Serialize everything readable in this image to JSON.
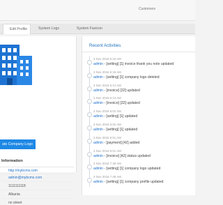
{
  "header": {
    "nav_label": "Customers"
  },
  "tabs": [
    {
      "label": "Edit Profile"
    },
    {
      "label": "System Logs"
    },
    {
      "label": "System Favicon"
    }
  ],
  "profile": {
    "update_logo_button": "ate Company Logo",
    "info_title": "Information",
    "info_items": [
      {
        "text": "http://mybcms.com"
      },
      {
        "text": "admin@mybcms.com"
      },
      {
        "text": "1111111118"
      },
      {
        "text": "Albania"
      },
      {
        "text": "no street"
      }
    ]
  },
  "recent_activities": {
    "title": "Recent Activities",
    "items": [
      {
        "time": "3 Nov 2016 6:16 AM",
        "user": "admin",
        "message": " - [setting] [1] invoice thank you note updated"
      },
      {
        "time": "3 Nov 2016 6:16 AM",
        "user": "admin",
        "message": " - [setting] [1] company logo deleted"
      },
      {
        "time": "3 Nov 2016 6:14 AM",
        "user": "admin",
        "message": " - [invoice] [32] updated"
      },
      {
        "time": "3 Nov 2016 6:13 AM",
        "user": "admin",
        "message": " - [invoice] [32] updated"
      },
      {
        "time": "3 Nov 2016 6:02 AM",
        "user": "admin",
        "message": " - [setting] [1] updated"
      },
      {
        "time": "3 Nov 2016 6:02 AM",
        "user": "admin",
        "message": " - [setting] [1] updated"
      },
      {
        "time": "3 Nov 2016 6:01 AM",
        "user": "admin",
        "message": " - [payment] [42] added"
      },
      {
        "time": "3 Nov 2016 6:01 AM",
        "user": "admin",
        "message": " - [invoice] [42] status updated"
      },
      {
        "time": "3 Nov 2016 7:49 AM",
        "user": "admin",
        "message": " - [setting] [1] company logo updated"
      },
      {
        "time": "3 Nov 2016 7:49 AM",
        "user": "admin",
        "message": " - [setting] [1] company profile updated"
      }
    ]
  },
  "colors": {
    "accent": "#1e88e5",
    "link": "#1e6fcc"
  },
  "icons": {
    "company_logo": "building-icon"
  }
}
